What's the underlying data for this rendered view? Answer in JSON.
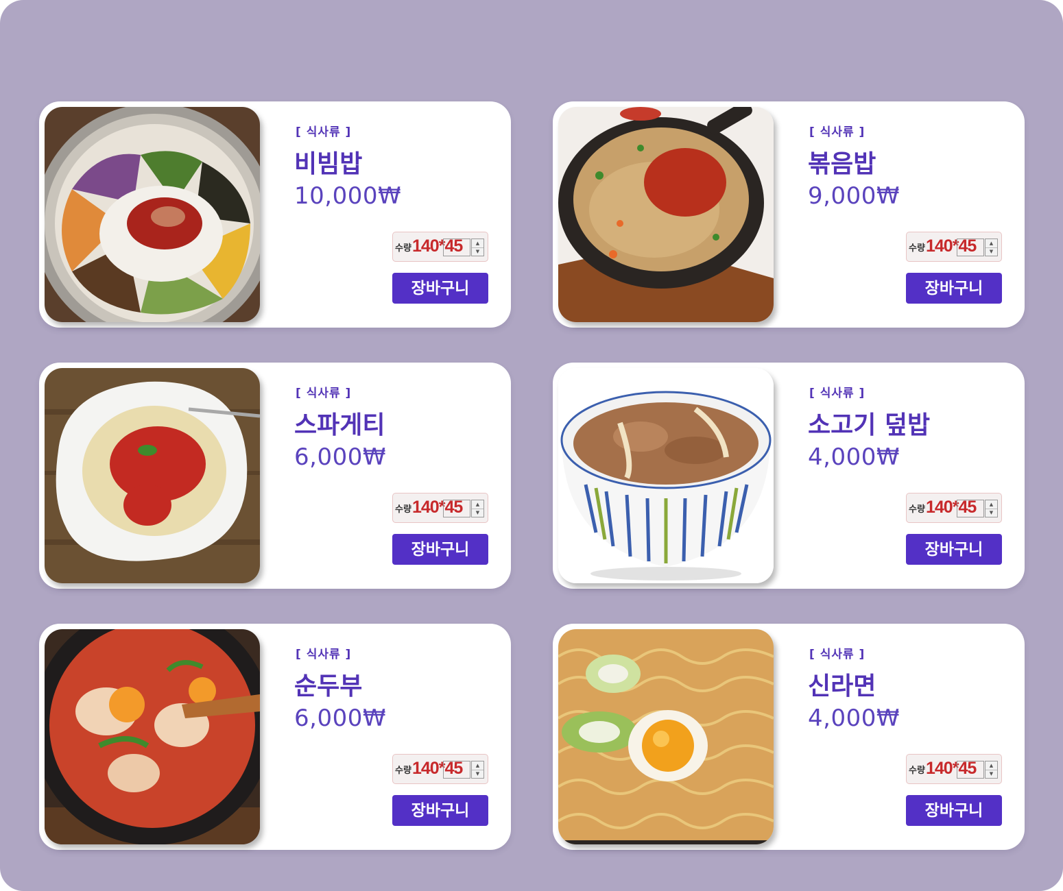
{
  "menu": {
    "items": [
      {
        "category": "[ 식사류 ]",
        "name": "비빔밥",
        "price": "10,000₩",
        "qty_label": "수량",
        "qty_dims": "140*45",
        "cart_label": "장바구니",
        "image_icon": "bibimbap-photo"
      },
      {
        "category": "[ 식사류 ]",
        "name": "볶음밥",
        "price": "9,000₩",
        "qty_label": "수량",
        "qty_dims": "140*45",
        "cart_label": "장바구니",
        "image_icon": "fried-rice-photo"
      },
      {
        "category": "[ 식사류 ]",
        "name": "스파게티",
        "price": "6,000₩",
        "qty_label": "수량",
        "qty_dims": "140*45",
        "cart_label": "장바구니",
        "image_icon": "spaghetti-photo"
      },
      {
        "category": "[ 식사류 ]",
        "name": "소고기 덮밥",
        "price": "4,000₩",
        "qty_label": "수량",
        "qty_dims": "140*45",
        "cart_label": "장바구니",
        "image_icon": "beef-bowl-photo"
      },
      {
        "category": "[ 식사류 ]",
        "name": "순두부",
        "price": "6,000₩",
        "qty_label": "수량",
        "qty_dims": "140*45",
        "cart_label": "장바구니",
        "image_icon": "sundubu-photo"
      },
      {
        "category": "[ 식사류 ]",
        "name": "신라면",
        "price": "4,000₩",
        "qty_label": "수량",
        "qty_dims": "140*45",
        "cart_label": "장바구니",
        "image_icon": "ramen-photo"
      }
    ]
  },
  "colors": {
    "background": "#afa6c3",
    "card": "#ffffff",
    "accent": "#5330c6",
    "price_text": "#5a43bd",
    "qty_text": "#c7292b"
  }
}
